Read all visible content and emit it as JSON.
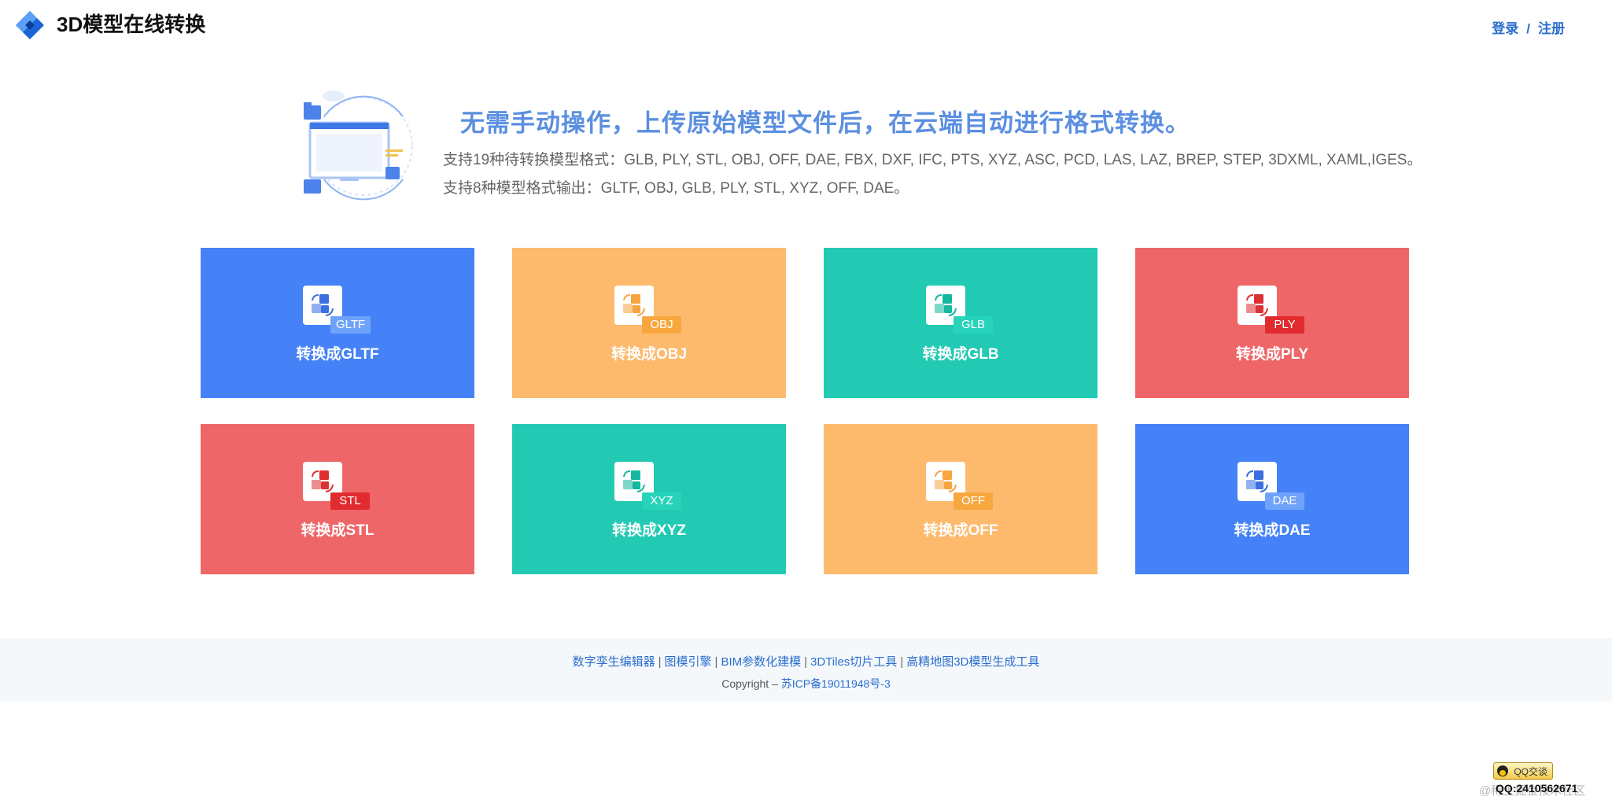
{
  "header": {
    "title": "3D模型在线转换",
    "login": "登录",
    "separator": "/",
    "register": "注册"
  },
  "hero": {
    "title": "无需手动操作，上传原始模型文件后，在云端自动进行格式转换。",
    "input_formats": "支持19种待转换模型格式：GLB, PLY, STL, OBJ, OFF, DAE, FBX, DXF, IFC, PTS, XYZ, ASC, PCD, LAS, LAZ, BREP, STEP, 3DXML, XAML,IGES。",
    "output_formats": "支持8种模型格式输出：GLTF, OBJ, GLB, PLY, STL, XYZ, OFF, DAE。"
  },
  "cards": [
    {
      "tag": "GLTF",
      "label": "转换成GLTF",
      "color": "#4582f8",
      "accent": "#3b6fe0",
      "tag_color": "#6fa3fb"
    },
    {
      "tag": "OBJ",
      "label": "转换成OBJ",
      "color": "#fdba6d",
      "accent": "#f7a441",
      "tag_color": "#f8a73e"
    },
    {
      "tag": "GLB",
      "label": "转换成GLB",
      "color": "#22cab3",
      "accent": "#13b89f",
      "tag_color": "#27d3bb"
    },
    {
      "tag": "PLY",
      "label": "转换成PLY",
      "color": "#ef6668",
      "accent": "#dd3033",
      "tag_color": "#e12b2e"
    },
    {
      "tag": "STL",
      "label": "转换成STL",
      "color": "#ef6668",
      "accent": "#dd3033",
      "tag_color": "#e12b2e"
    },
    {
      "tag": "XYZ",
      "label": "转换成XYZ",
      "color": "#22cab3",
      "accent": "#13b89f",
      "tag_color": "#27d3bb"
    },
    {
      "tag": "OFF",
      "label": "转换成OFF",
      "color": "#fdba6d",
      "accent": "#f7a441",
      "tag_color": "#f8a73e"
    },
    {
      "tag": "DAE",
      "label": "转换成DAE",
      "color": "#4582f8",
      "accent": "#3b6fe0",
      "tag_color": "#6fa3fb"
    }
  ],
  "footer": {
    "links": [
      "数字孪生编辑器",
      "图模引擎",
      "BIM参数化建模",
      "3DTiles切片工具",
      "高精地图3D模型生成工具"
    ],
    "copyright_prefix": "Copyright – ",
    "icp": "苏ICP备19011948号-3"
  },
  "widget": {
    "qq_button": "QQ交谈",
    "qq_number": "QQ:2410562671"
  },
  "watermark": "@稀土掘金技术社区"
}
